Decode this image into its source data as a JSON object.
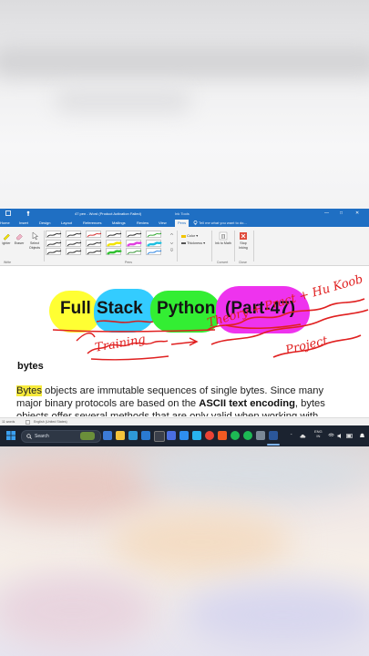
{
  "window": {
    "title": "47 pen - Word (Product Activation Failed)",
    "context_tab": "Ink Tools",
    "controls": [
      "—",
      "□",
      "✕"
    ]
  },
  "tabs": {
    "items": [
      "Home",
      "Insert",
      "Design",
      "Layout",
      "References",
      "Mailings",
      "Review",
      "View",
      "Pens"
    ],
    "active": "Pens",
    "tell_me": "Tell me what you want to do..."
  },
  "ribbon": {
    "highlighter_label": "ighter",
    "eraser_label": "Eraser",
    "select_objects_label": "Select Objects",
    "write_group": "Write",
    "pens_group": "Pens",
    "color_label": "Color",
    "thickness_label": "Thickness",
    "ink_to_math_label": "Ink to Math",
    "convert_group": "Convert",
    "stop_inking_label": "Stop Inking",
    "close_group": "Close",
    "pen_colors": [
      "#202020",
      "#202020",
      "#d02020",
      "#202020",
      "#202020",
      "#20a020",
      "#202020",
      "#202020",
      "#202020",
      "#f2e400",
      "#e040e0",
      "#20c0e0",
      "#202020",
      "#202020",
      "#202020",
      "#30c030",
      "#2a8f2a",
      "#1d7be0"
    ]
  },
  "document": {
    "title_words": [
      "Full",
      "Stack",
      "Python",
      "(Part-47)"
    ],
    "highlight_colors": [
      "#ffff33",
      "#33ccff",
      "#33ee33",
      "#ee33ee"
    ],
    "ink_annotations": [
      "Training",
      "Theory + Pract + Hu Koob",
      "Project"
    ],
    "heading": "bytes",
    "para_highlight": "Bytes",
    "para_line1_rest": " objects are immutable sequences of single bytes. Since many",
    "para_line2_a": "major binary protocols are based on the ",
    "para_line2_bold": "ASCII text encoding",
    "para_line2_b": ", bytes",
    "para_line3": "objects offer several methods that are only valid when working with"
  },
  "statusbar": {
    "words": "11 words",
    "language": "English (United States)"
  },
  "taskbar": {
    "search_label": "Search",
    "lang_top": "ENG",
    "lang_bottom": "IN",
    "apps": [
      "widgets",
      "file-explorer",
      "edge",
      "vscode",
      "terminal",
      "store",
      "chrome",
      "brave",
      "spotify",
      "word"
    ]
  }
}
